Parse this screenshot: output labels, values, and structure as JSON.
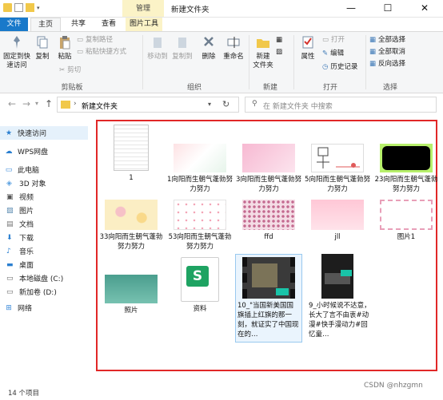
{
  "window": {
    "title": "新建文件夹",
    "context_tab": "管理",
    "minimize": "—",
    "maximize": "☐",
    "close": "✕"
  },
  "tabs": [
    {
      "label": "文件"
    },
    {
      "label": "主页"
    },
    {
      "label": "共享"
    },
    {
      "label": "查看"
    },
    {
      "label": "图片工具"
    }
  ],
  "ribbon": {
    "clipboard": {
      "group": "剪贴板",
      "pin": "固定到快\n速访问",
      "copy": "复制",
      "paste": "粘贴",
      "copy_path": "复制路径",
      "paste_shortcut": "粘贴快捷方式",
      "cut": "剪切"
    },
    "organize": {
      "group": "组织",
      "move_to": "移动到",
      "copy_to": "复制到",
      "delete": "删除",
      "rename": "重命名"
    },
    "new": {
      "group": "新建",
      "new_folder": "新建\n文件夹"
    },
    "open": {
      "group": "打开",
      "properties": "属性",
      "open": "打开",
      "edit": "编辑",
      "history": "历史记录"
    },
    "select": {
      "group": "选择",
      "select_all": "全部选择",
      "select_none": "全部取消",
      "invert": "反向选择"
    }
  },
  "address": {
    "path": "新建文件夹",
    "search_placeholder": "在 新建文件夹 中搜索"
  },
  "nav": [
    {
      "label": "快速访问",
      "icon": "star-icon"
    },
    {
      "label": "WPS网盘",
      "icon": "cloud-icon"
    },
    {
      "label": "此电脑",
      "icon": "computer-icon"
    },
    {
      "label": "3D 对象",
      "icon": "cube-icon"
    },
    {
      "label": "视频",
      "icon": "video-icon"
    },
    {
      "label": "图片",
      "icon": "picture-icon"
    },
    {
      "label": "文档",
      "icon": "document-icon"
    },
    {
      "label": "下载",
      "icon": "download-icon"
    },
    {
      "label": "音乐",
      "icon": "music-icon"
    },
    {
      "label": "桌面",
      "icon": "desktop-icon"
    },
    {
      "label": "本地磁盘 (C:)",
      "icon": "drive-icon"
    },
    {
      "label": "新加卷 (D:)",
      "icon": "drive-icon"
    },
    {
      "label": "网络",
      "icon": "network-icon"
    }
  ],
  "files": [
    {
      "name": "1",
      "kind": "blank-file"
    },
    {
      "name": "1向阳而生朝气蓬勃努力努力",
      "kind": "image-pastel"
    },
    {
      "name": "3向阳而生朝气蓬勃努力努力",
      "kind": "image-pink"
    },
    {
      "name": "5向阳而生朝气蓬勃努力努力",
      "kind": "image-sketch"
    },
    {
      "name": "23向阳而生朝气蓬勃努力努力",
      "kind": "image-green-black"
    },
    {
      "name": "33向阳而生朝气蓬勃努力努力",
      "kind": "image-yellow-floral"
    },
    {
      "name": "53向阳而生朝气蓬勃努力努力",
      "kind": "image-white-dots"
    },
    {
      "name": "ffd",
      "kind": "image-pattern"
    },
    {
      "name": "jll",
      "kind": "image-pink-sky"
    },
    {
      "name": "图片1",
      "kind": "image-frame"
    },
    {
      "name": "照片",
      "kind": "image-teal"
    },
    {
      "name": "资料",
      "kind": "spreadsheet"
    },
    {
      "name": "10_\"当国新美国国旗插上红旗的那一刻，就证实了中国现在的…",
      "kind": "video"
    },
    {
      "name": "9_小时候说不达意，长大了言不由衷#动漫#快手漫动力#回忆童…",
      "kind": "video-dark"
    }
  ],
  "status": {
    "count": "14 个项目"
  },
  "watermark": "CSDN @nhzgmn"
}
